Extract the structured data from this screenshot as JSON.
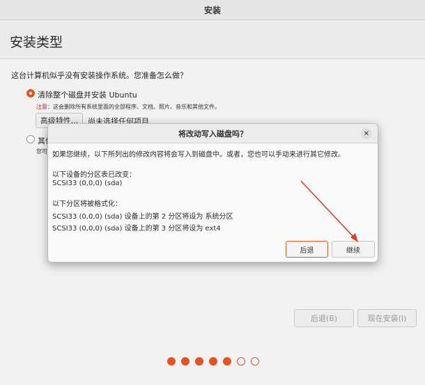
{
  "window": {
    "title": "安装"
  },
  "page": {
    "title": "安装类型"
  },
  "question": "这台计算机似乎没有安装操作系统。您准备怎么做？",
  "options": {
    "erase": {
      "label": "清除整个磁盘并安装 Ubuntu",
      "note_prefix": "注意：",
      "note_text": "这会删除所有系统里面的全部程序、文档、照片、音乐和其他文件。",
      "selected": true
    },
    "advanced_button": "高级特性...",
    "advanced_status": "尚未选择任何项目",
    "other": {
      "label": "其他",
      "sub": "您可",
      "selected": false
    }
  },
  "nav": {
    "back": "后退(B)",
    "install_now": "现在安装(I)"
  },
  "progress": {
    "total": 7,
    "completed": 5
  },
  "dialog": {
    "title": "将改动写入磁盘吗？",
    "close_icon": "close-icon",
    "intro": "如果您继续，以下所列出的修改内容将会写入到磁盘中。或者，您也可以手动来进行其它修改。",
    "partition_table_heading": "以下设备的分区表已改变：",
    "partition_table_device": "SCSI33 (0,0,0) (sda)",
    "format_heading": "以下分区将被格式化：",
    "format_items": [
      "SCSI33 (0,0,0) (sda) 设备上的第 2 分区将设为 系统分区",
      "SCSI33 (0,0,0) (sda) 设备上的第 3 分区将设为 ext4"
    ],
    "back_button": "后退",
    "continue_button": "继续"
  },
  "colors": {
    "accent": "#e95420",
    "annotation_arrow": "#e03a2f"
  }
}
